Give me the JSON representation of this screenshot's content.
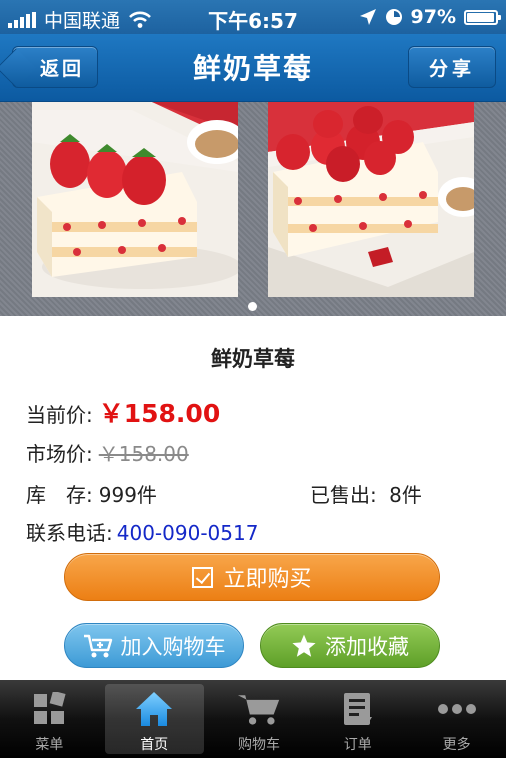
{
  "status_bar": {
    "carrier": "中国联通",
    "time": "下午6:57",
    "battery": "97%",
    "battery_level": 0.97
  },
  "nav": {
    "back_label": "返回",
    "title": "鲜奶草莓",
    "share_label": "分享"
  },
  "gallery": {
    "page_count": 1,
    "current_page": 1
  },
  "product": {
    "name": "鲜奶草莓",
    "current_price_label": "当前价:",
    "current_price": "￥158.00",
    "market_price_label": "市场价:",
    "market_price": "￥158.00",
    "stock_label": "库　存:",
    "stock_value": "999件",
    "sold_label": "已售出:",
    "sold_value": "8件",
    "phone_label": "联系电话:",
    "phone": "400-090-0517"
  },
  "actions": {
    "buy_label": "立即购买",
    "cart_label": "加入购物车",
    "fav_label": "添加收藏"
  },
  "tabs": [
    {
      "label": "菜单",
      "icon": "grid-icon"
    },
    {
      "label": "首页",
      "icon": "home-icon",
      "active": true
    },
    {
      "label": "购物车",
      "icon": "cart-icon"
    },
    {
      "label": "订单",
      "icon": "order-icon"
    },
    {
      "label": "更多",
      "icon": "more-icon"
    }
  ],
  "colors": {
    "nav_blue": "#1f78c2",
    "price_red": "#e11212",
    "buy_orange": "#ec7f14",
    "cart_blue": "#3d9ad6",
    "fav_green": "#5ea028",
    "phone_blue": "#1428c8"
  }
}
